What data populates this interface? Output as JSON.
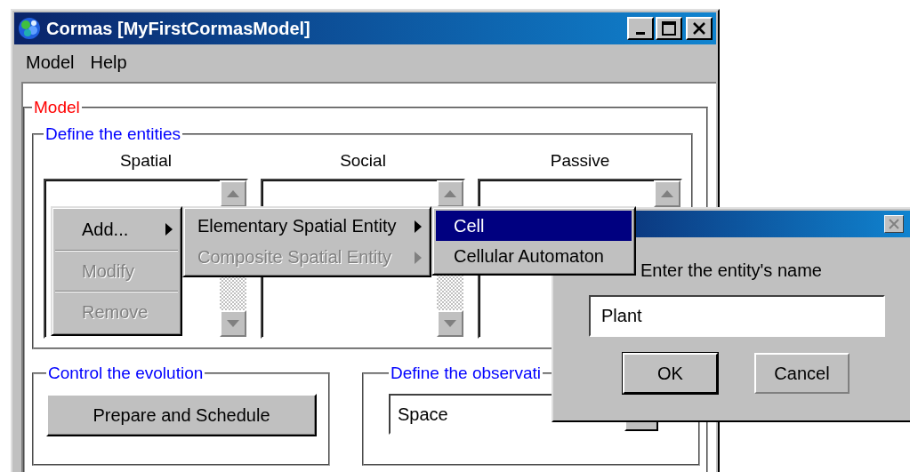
{
  "window": {
    "title": "Cormas [MyFirstCormasModel]"
  },
  "menu": [
    {
      "label": "Model"
    },
    {
      "label": "Help"
    }
  ],
  "model_group": {
    "title": "Model",
    "entities_group": {
      "title": "Define the entities",
      "columns": [
        {
          "heading": "Spatial"
        },
        {
          "heading": "Social"
        },
        {
          "heading": "Passive"
        }
      ]
    },
    "evolution_group": {
      "title": "Control the evolution",
      "button": "Prepare and Schedule"
    },
    "observation_group": {
      "title": "Define the observati",
      "combo_value": "Space"
    }
  },
  "context_menu": {
    "items": [
      {
        "label": "Add...",
        "disabled": false,
        "submenu": true
      },
      {
        "label": "Modify",
        "disabled": true,
        "submenu": false
      },
      {
        "label": "Remove",
        "disabled": true,
        "submenu": false
      }
    ]
  },
  "submenu": {
    "items": [
      {
        "label": "Elementary Spatial Entity",
        "disabled": false,
        "submenu": true
      },
      {
        "label": "Composite Spatial Entity",
        "disabled": true,
        "submenu": true
      }
    ]
  },
  "subsubmenu": {
    "items": [
      {
        "label": "Cell",
        "selected": true
      },
      {
        "label": "Cellular Automaton",
        "selected": false
      }
    ]
  },
  "dialog": {
    "prompt": "Enter the entity's name",
    "value": "Plant",
    "buttons": [
      {
        "label": "OK",
        "default": true
      },
      {
        "label": "Cancel",
        "default": false
      }
    ]
  }
}
